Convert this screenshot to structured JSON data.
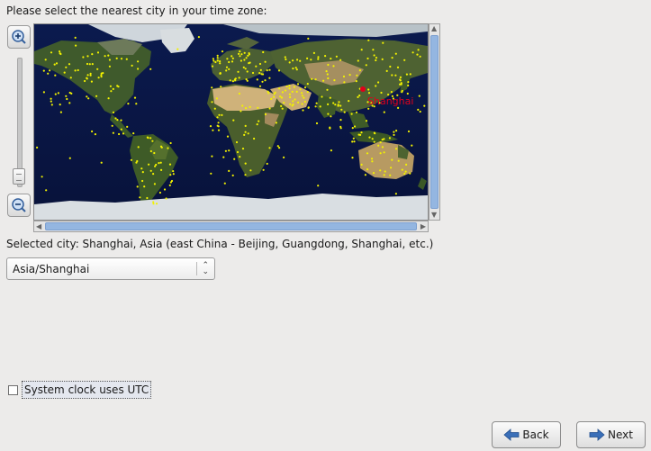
{
  "prompt": "Please select the nearest city in your time zone:",
  "map": {
    "highlighted_city": "Shanghai",
    "highlight_color": "#e0001c",
    "city_dot_color": "#f2f200"
  },
  "selected_city_text": "Selected city: Shanghai, Asia (east China - Beijing, Guangdong, Shanghai, etc.)",
  "timezone_select": {
    "value": "Asia/Shanghai"
  },
  "utc_checkbox": {
    "label": "System clock uses UTC",
    "checked": false
  },
  "buttons": {
    "back": "Back",
    "next": "Next"
  },
  "icons": {
    "zoom_in": "zoom-in-icon",
    "zoom_out": "zoom-out-icon",
    "back": "back-arrow-icon",
    "next": "next-arrow-icon"
  }
}
